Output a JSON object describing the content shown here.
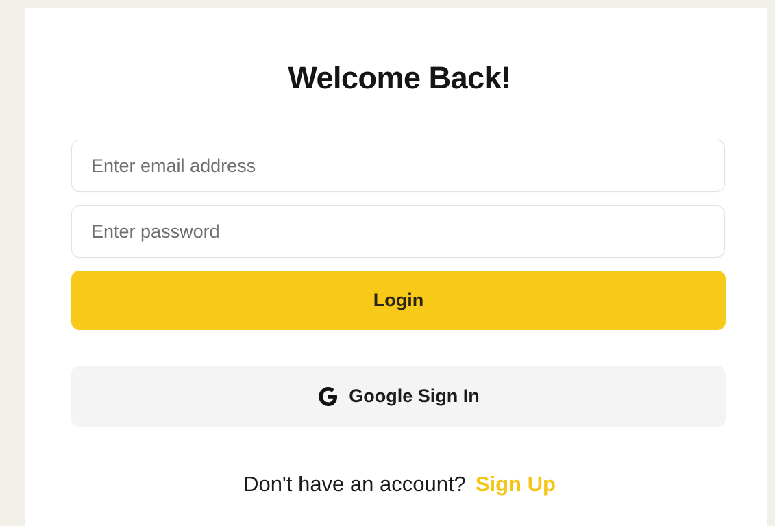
{
  "login_card": {
    "title": "Welcome Back!",
    "email_input": {
      "placeholder": "Enter email address",
      "value": ""
    },
    "password_input": {
      "placeholder": "Enter password",
      "value": ""
    },
    "login_button_label": "Login",
    "google_button": {
      "label": "Google Sign In",
      "icon": "google-g-icon"
    },
    "signup_prompt": "Don't have an account?",
    "signup_link_label": "Sign Up"
  },
  "colors": {
    "page_background": "#f2efe8",
    "card_background": "#ffffff",
    "accent_yellow": "#f7c919",
    "google_button_background": "#f4f4f4",
    "signup_link": "#f5c518"
  }
}
